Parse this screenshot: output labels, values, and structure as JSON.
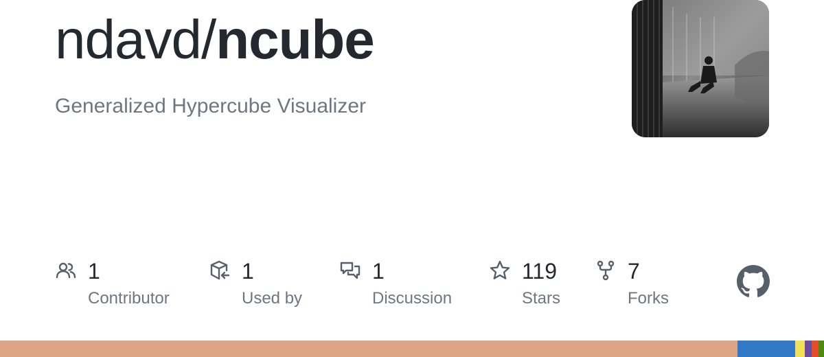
{
  "repo": {
    "owner": "ndavd/",
    "name": "ncube",
    "description": "Generalized Hypercube Visualizer"
  },
  "stats": [
    {
      "value": "1",
      "label": "Contributor",
      "icon": "people-icon"
    },
    {
      "value": "1",
      "label": "Used by",
      "icon": "package-dependents-icon"
    },
    {
      "value": "1",
      "label": "Discussion",
      "icon": "comment-discussion-icon"
    },
    {
      "value": "119",
      "label": "Stars",
      "icon": "star-icon"
    },
    {
      "value": "7",
      "label": "Forks",
      "icon": "repo-forked-icon"
    }
  ],
  "brand_icon": "github-mark-icon",
  "language_bar": [
    {
      "color": "#dea584",
      "share": 0.895
    },
    {
      "color": "#3178c6",
      "share": 0.07
    },
    {
      "color": "#f1e05a",
      "share": 0.0117
    },
    {
      "color": "#6e4c9f",
      "share": 0.0083
    },
    {
      "color": "#e34c26",
      "share": 0.0083
    },
    {
      "color": "#4f8a10",
      "share": 0.0067
    }
  ],
  "colors": {
    "text_primary": "#24292f",
    "text_secondary": "#6e7781",
    "icon": "#57606a"
  }
}
